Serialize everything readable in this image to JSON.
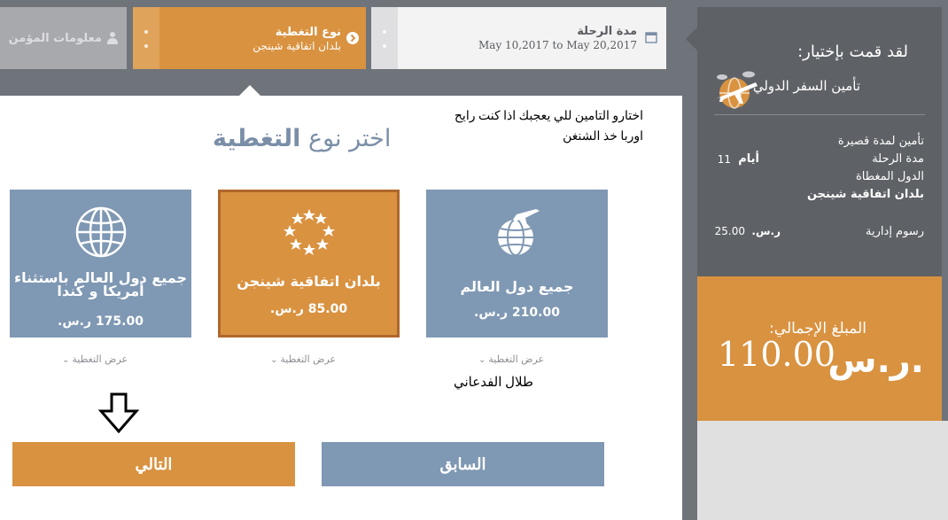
{
  "steps": {
    "insured_info": {
      "label": "معلومات المؤمن",
      "icon": "users-icon"
    },
    "coverage": {
      "title": "نوع التغطية",
      "value": "بلدان اتفاقية شينجن",
      "icon": "chevron-circle-icon"
    },
    "duration": {
      "title": "مدة الرحلة",
      "dates": "May 10,2017 to May 20,2017",
      "icon": "calendar-icon"
    }
  },
  "note_lines": [
    "اختارو التامين للي يعجبك اذا كنت رايح",
    "اوربا خذ الشنغن"
  ],
  "heading": {
    "light": "اختر نوع",
    "bold": "التغطية"
  },
  "plans": [
    {
      "name": "جميع دول العالم",
      "price": "210.00 ر.س.",
      "icon": "world-plane-icon",
      "view": "عرض التغطية",
      "selected": false
    },
    {
      "name": "بلدان اتفاقية شينجن",
      "price": "85.00 ر.س.",
      "icon": "eu-stars-icon",
      "view": "عرض التغطية",
      "selected": true
    },
    {
      "name": "جميع دول العالم باستثناء أمريكا و كندا",
      "price": "175.00 ر.س.",
      "icon": "globe-icon",
      "view": "عرض التغطية",
      "selected": false
    }
  ],
  "signer": "طلال الفدعاني",
  "buttons": {
    "next": "التالي",
    "prev": "السابق"
  },
  "summary": {
    "title": "لقد قمت بإختيار:",
    "insurance_type": "تأمين السفر الدولي",
    "plan_type": "تأمين لمدة قصيرة",
    "duration_label": "مدة الرحلة",
    "duration_value": "11",
    "duration_unit": "أيام",
    "regions_label": "الدول المغطاة",
    "regions_value": "بلدان اتفاقية شينجن",
    "fee_label": "رسوم إدارية",
    "fee_currency": "ر.س.",
    "fee_value": "25.00"
  },
  "total": {
    "label": "المبلغ الإجمالي:",
    "currency": "ر.س.",
    "amount": "110.00"
  },
  "colors": {
    "accent": "#d99240",
    "plan_blue": "#7f98b3",
    "dark_panel": "#5e6166"
  }
}
